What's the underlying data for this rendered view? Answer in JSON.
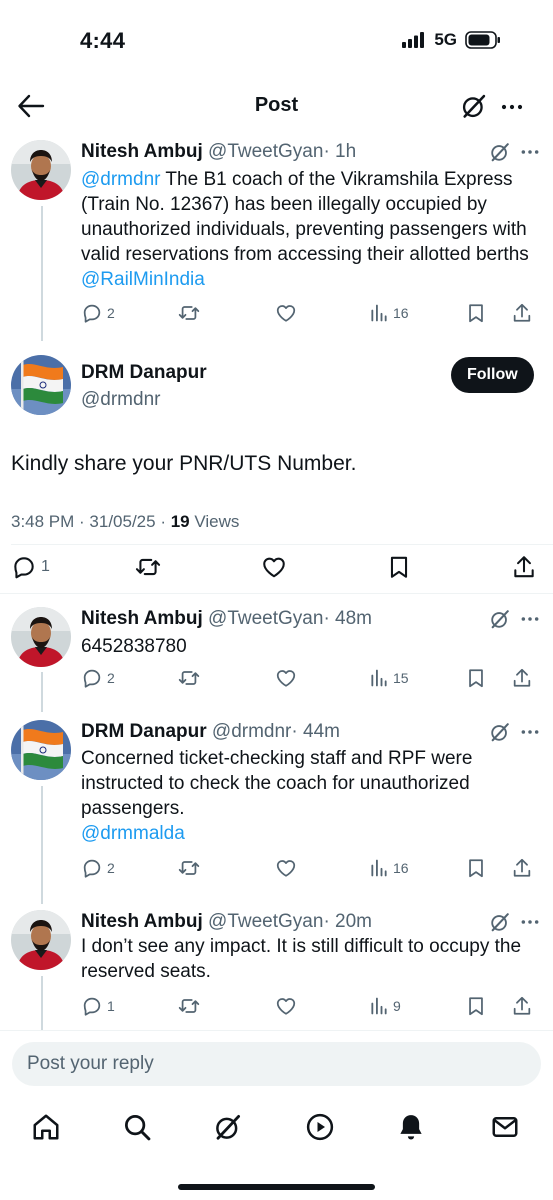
{
  "status_bar": {
    "time": "4:44",
    "network": "5G"
  },
  "header": {
    "title": "Post"
  },
  "tweets": [
    {
      "name": "Nitesh Ambuj",
      "handle": "@TweetGyan",
      "time": "· 1h",
      "mention": "@drmdnr",
      "text": " The B1 coach of the Vikramshila Express (Train No. 12367) has been illegally occupied by unauthorized individuals, preventing passengers with valid reservations from accessing their allotted berths ",
      "mention_end": "@RailMinIndia",
      "replies": "2",
      "views": "16"
    },
    {
      "name": "Nitesh Ambuj",
      "handle": "@TweetGyan",
      "time": "· 48m",
      "text": "6452838780",
      "replies": "2",
      "views": "15"
    },
    {
      "name": "DRM Danapur",
      "handle": "@drmdnr",
      "time": "· 44m",
      "text": "Concerned ticket-checking staff and RPF were instructed to check the coach for unauthorized passengers.",
      "mention_end": "@drmmalda",
      "replies": "2",
      "views": "16"
    },
    {
      "name": "Nitesh Ambuj",
      "handle": "@TweetGyan",
      "time": "· 20m",
      "text": "I don’t see any impact. It is still difficult to occupy the reserved seats.",
      "replies": "1",
      "views": "9"
    }
  ],
  "main_post": {
    "name": "DRM Danapur",
    "handle": "@drmdnr",
    "follow_label": "Follow",
    "text": "Kindly share your PNR/UTS Number.",
    "timestamp": "3:48 PM · 31/05/25 · ",
    "views_count": "19",
    "views_label": " Views",
    "replies": "1"
  },
  "reply_box": {
    "placeholder": "Post your reply"
  },
  "icons": {
    "back": "arrow-left-icon",
    "grok": "grok-icon",
    "more": "more-icon",
    "reply": "reply-icon",
    "repost": "repost-icon",
    "like": "like-icon",
    "views": "views-icon",
    "bookmark": "bookmark-icon",
    "share": "share-icon",
    "nav": [
      "home-icon",
      "search-icon",
      "grok-icon",
      "video-icon",
      "notifications-icon",
      "messages-icon"
    ]
  },
  "colors": {
    "accent": "#1d9bf0",
    "text": "#0f1419",
    "muted": "#536471"
  }
}
